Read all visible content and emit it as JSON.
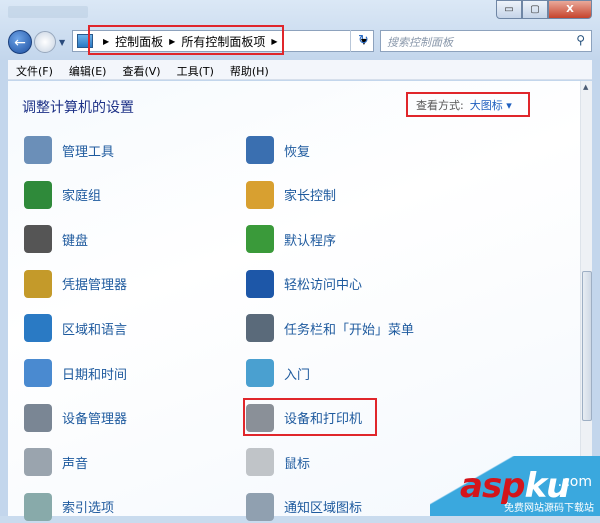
{
  "window": {
    "buttons": {
      "minimize": "▭",
      "maximize": "▢",
      "close": "X"
    }
  },
  "address": {
    "crumbs": [
      "控制面板",
      "所有控制面板项"
    ],
    "search_placeholder": "搜索控制面板"
  },
  "menu": [
    "文件(F)",
    "编辑(E)",
    "查看(V)",
    "工具(T)",
    "帮助(H)"
  ],
  "main": {
    "heading": "调整计算机的设置",
    "view_by_label": "查看方式:",
    "view_by_value": "大图标 ▾"
  },
  "items_left": [
    {
      "label": "管理工具",
      "icon": "admin-tools-icon"
    },
    {
      "label": "家庭组",
      "icon": "homegroup-icon"
    },
    {
      "label": "键盘",
      "icon": "keyboard-icon"
    },
    {
      "label": "凭据管理器",
      "icon": "credential-manager-icon"
    },
    {
      "label": "区域和语言",
      "icon": "region-language-icon"
    },
    {
      "label": "日期和时间",
      "icon": "date-time-icon"
    },
    {
      "label": "设备管理器",
      "icon": "device-manager-icon"
    },
    {
      "label": "声音",
      "icon": "sound-icon"
    },
    {
      "label": "索引选项",
      "icon": "indexing-icon"
    }
  ],
  "items_right": [
    {
      "label": "恢复",
      "icon": "recovery-icon"
    },
    {
      "label": "家长控制",
      "icon": "parental-controls-icon"
    },
    {
      "label": "默认程序",
      "icon": "default-programs-icon"
    },
    {
      "label": "轻松访问中心",
      "icon": "ease-of-access-icon"
    },
    {
      "label": "任务栏和「开始」菜单",
      "icon": "taskbar-icon"
    },
    {
      "label": "入门",
      "icon": "getting-started-icon"
    },
    {
      "label": "设备和打印机",
      "icon": "devices-printers-icon"
    },
    {
      "label": "鼠标",
      "icon": "mouse-icon"
    },
    {
      "label": "通知区域图标",
      "icon": "notification-icons-icon"
    }
  ],
  "watermark": {
    "brand": "aspku",
    "domain": ".com",
    "tagline": "免费网站源码下载站"
  }
}
